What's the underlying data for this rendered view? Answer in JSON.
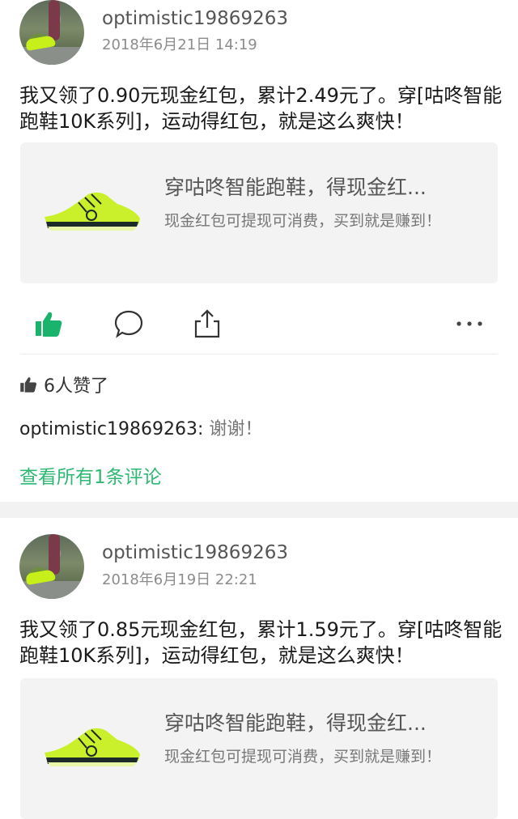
{
  "feed": [
    {
      "username": "optimistic19869263",
      "timestamp": "2018年6月21日 14:19",
      "text": "我又领了0.90元现金红包，累计2.49元了。穿[咕咚智能跑鞋10K系列]，运动得红包，就是这么爽快！",
      "card": {
        "title": "穿咕咚智能跑鞋，得现金红...",
        "description": "现金红包可提现可消费，买到就是赚到！"
      },
      "likes_text": "6人赞了",
      "comment": {
        "author": "optimistic19869263",
        "separator": ": ",
        "text": "谢谢！"
      },
      "view_all": "查看所有1条评论"
    },
    {
      "username": "optimistic19869263",
      "timestamp": "2018年6月19日 22:21",
      "text": "我又领了0.85元现金红包，累计1.59元了。穿[咕咚智能跑鞋10K系列]，运动得红包，就是这么爽快！",
      "card": {
        "title": "穿咕咚智能跑鞋，得现金红...",
        "description": "现金红包可提现可消费，买到就是赚到！"
      }
    }
  ],
  "icons": {
    "like": "thumbs-up-icon",
    "comment": "comment-bubble-icon",
    "share": "share-icon",
    "more": "more-dots-icon"
  },
  "colors": {
    "accent_green": "#2eb872",
    "like_green": "#19b36b",
    "separator": "#f2f2f2"
  }
}
